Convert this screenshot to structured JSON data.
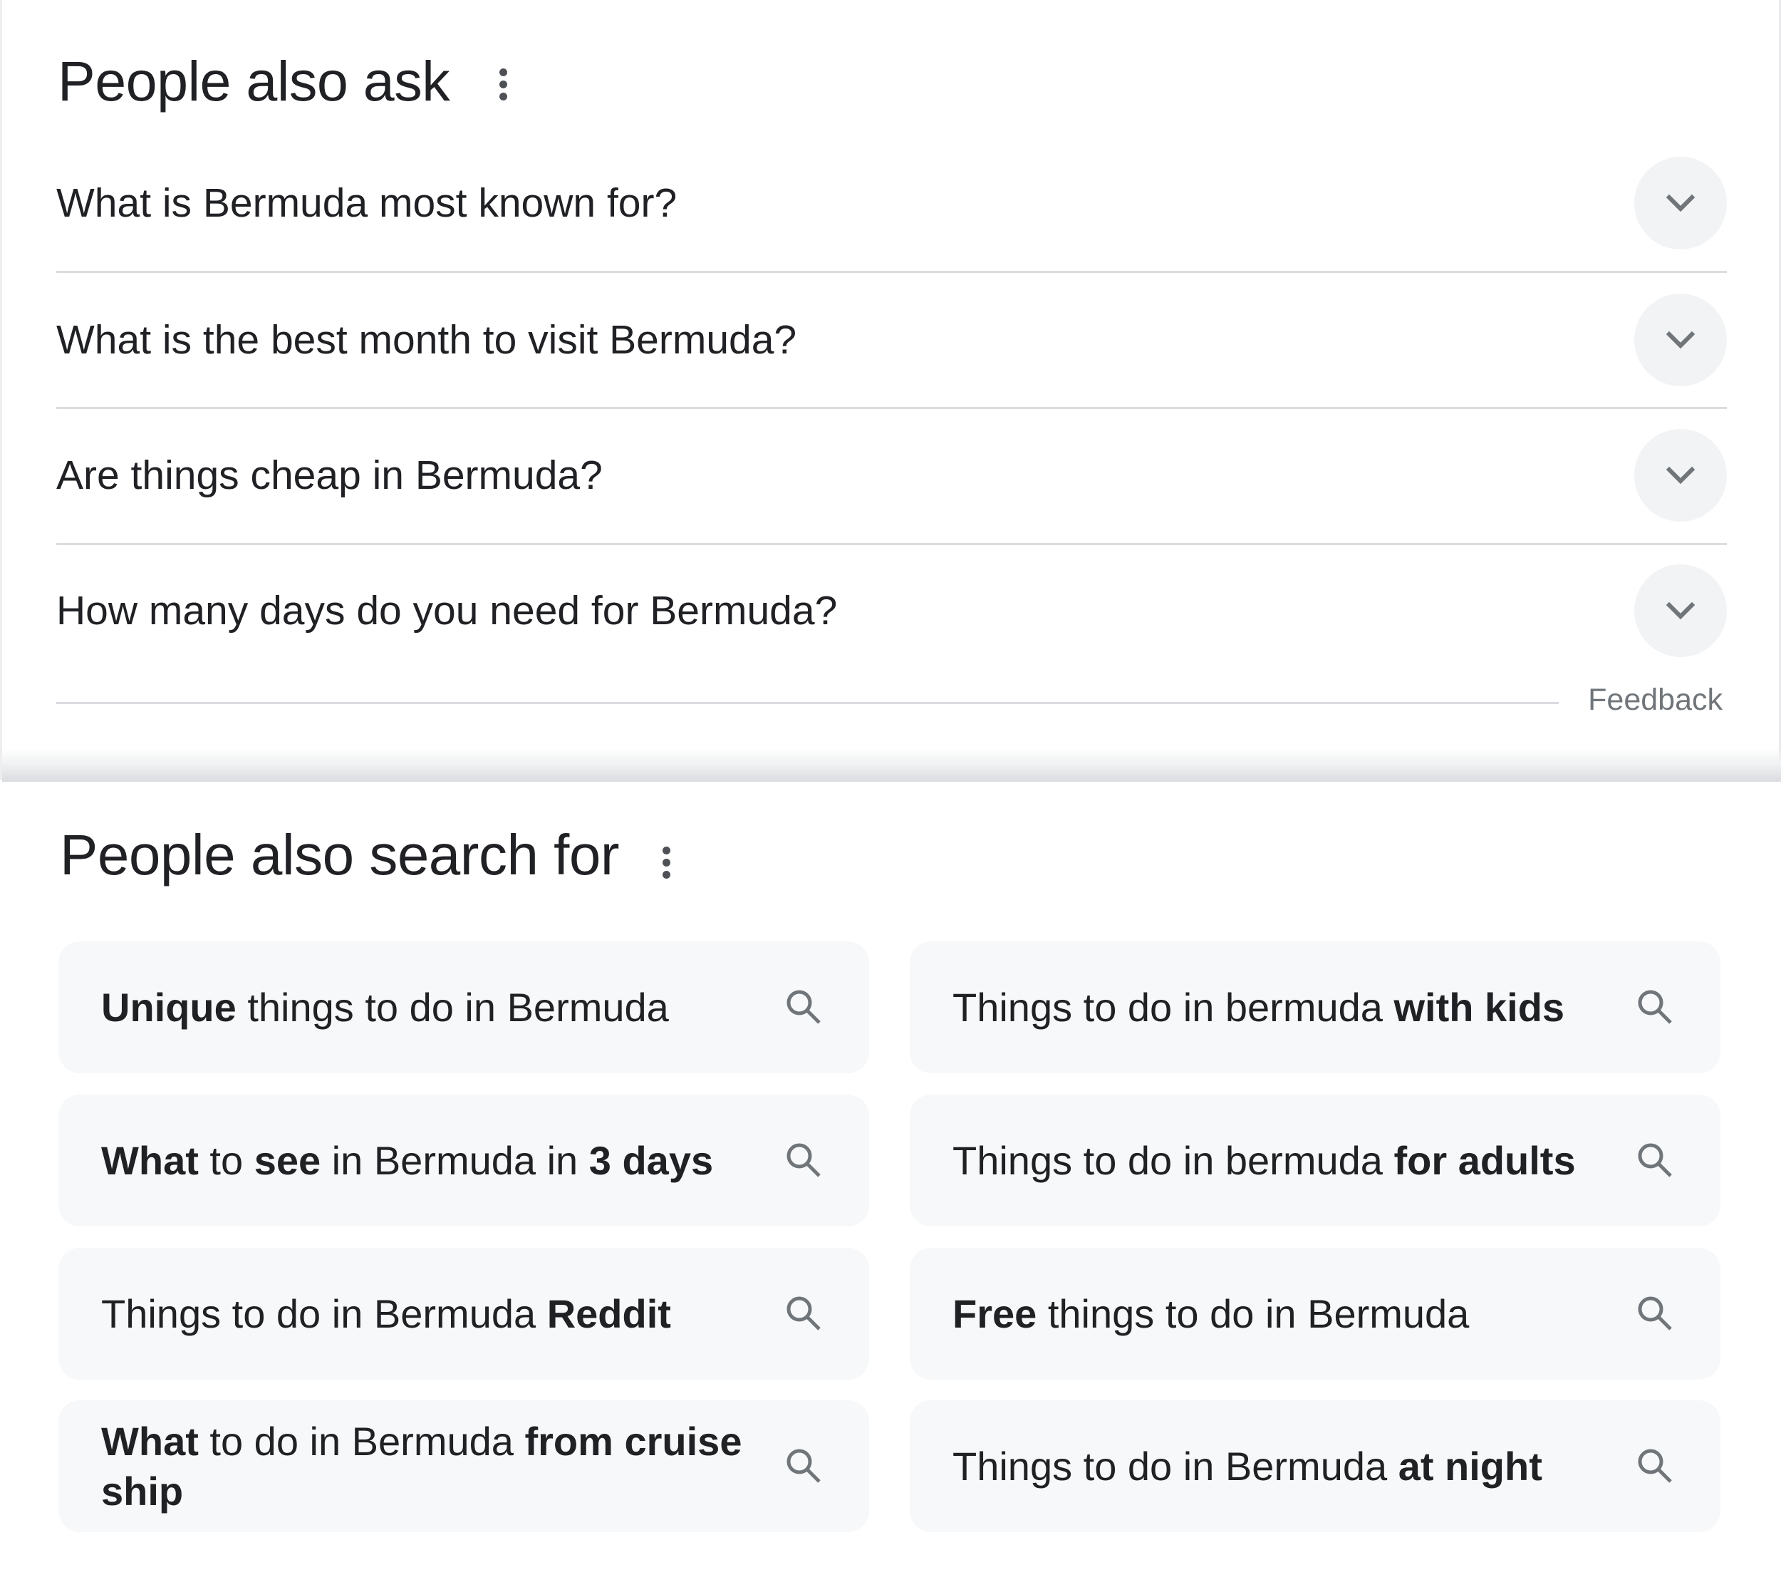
{
  "people_also_ask": {
    "title": "People also ask",
    "menu_icon": "more-vert-icon",
    "questions": [
      {
        "text": "What is Bermuda most known for?",
        "icon": "chevron-down-icon"
      },
      {
        "text": "What is the best month to visit Bermuda?",
        "icon": "chevron-down-icon"
      },
      {
        "text": "Are things cheap in Bermuda?",
        "icon": "chevron-down-icon"
      },
      {
        "text": "How many days do you need for Bermuda?",
        "icon": "chevron-down-icon"
      }
    ],
    "feedback_label": "Feedback"
  },
  "people_also_search_for": {
    "title": "People also search for",
    "menu_icon": "more-vert-icon",
    "search_icon": "search-icon",
    "suggestions": [
      {
        "parts": [
          {
            "text": "Unique",
            "bold": true
          },
          {
            "text": " things to do in Bermuda",
            "bold": false
          }
        ]
      },
      {
        "parts": [
          {
            "text": "Things to do in bermuda ",
            "bold": false
          },
          {
            "text": "with kids",
            "bold": true
          }
        ]
      },
      {
        "parts": [
          {
            "text": "What",
            "bold": true
          },
          {
            "text": " to ",
            "bold": false
          },
          {
            "text": "see",
            "bold": true
          },
          {
            "text": " in Bermuda in ",
            "bold": false
          },
          {
            "text": "3 days",
            "bold": true
          }
        ]
      },
      {
        "parts": [
          {
            "text": "Things to do in bermuda ",
            "bold": false
          },
          {
            "text": "for adults",
            "bold": true
          }
        ]
      },
      {
        "parts": [
          {
            "text": "Things to do in Bermuda ",
            "bold": false
          },
          {
            "text": "Reddit",
            "bold": true
          }
        ]
      },
      {
        "parts": [
          {
            "text": "Free",
            "bold": true
          },
          {
            "text": " things to do in Bermuda",
            "bold": false
          }
        ]
      },
      {
        "parts": [
          {
            "text": "What",
            "bold": true
          },
          {
            "text": " to do in Bermuda ",
            "bold": false
          },
          {
            "text": "from cruise ship",
            "bold": true
          }
        ]
      },
      {
        "parts": [
          {
            "text": "Things to do in Bermuda ",
            "bold": false
          },
          {
            "text": "at night",
            "bold": true
          }
        ]
      }
    ]
  },
  "colors": {
    "text_primary": "#202124",
    "text_secondary": "#70757a",
    "icon": "#70757a",
    "chip_background": "#f7f8f9",
    "button_background": "#f1f3f4",
    "divider": "#dadce0"
  }
}
